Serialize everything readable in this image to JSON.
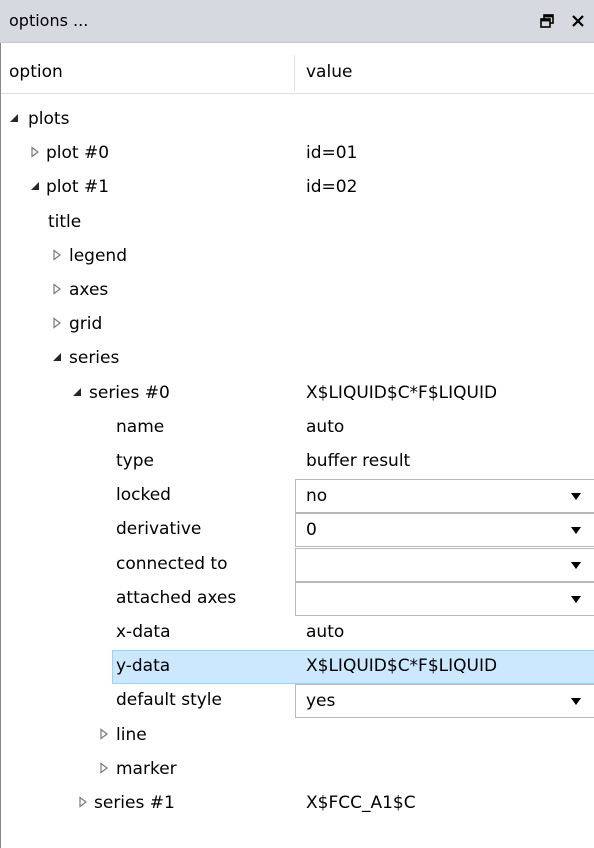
{
  "window": {
    "title": "options ...",
    "float_icon": "restore-window-icon",
    "close_icon": "close-icon"
  },
  "columns": {
    "option": "option",
    "value": "value"
  },
  "rows": [
    {
      "label": "plots",
      "value": "",
      "expander": "expanded"
    },
    {
      "label": "plot #0",
      "value": "id=01",
      "expander": "collapsed"
    },
    {
      "label": "plot #1",
      "value": "id=02",
      "expander": "expanded"
    },
    {
      "label": "title",
      "value": "",
      "expander": "none"
    },
    {
      "label": "legend",
      "value": "",
      "expander": "collapsed"
    },
    {
      "label": "axes",
      "value": "",
      "expander": "collapsed"
    },
    {
      "label": "grid",
      "value": "",
      "expander": "collapsed"
    },
    {
      "label": "series",
      "value": "",
      "expander": "expanded"
    },
    {
      "label": "series #0",
      "value": "X$LIQUID$C*F$LIQUID",
      "expander": "expanded"
    },
    {
      "label": "name",
      "value": "auto",
      "expander": "none"
    },
    {
      "label": "type",
      "value": "buffer result",
      "expander": "none"
    },
    {
      "label": "locked",
      "value": "no",
      "expander": "none",
      "editor": "combo"
    },
    {
      "label": "derivative",
      "value": "0",
      "expander": "none",
      "editor": "combo"
    },
    {
      "label": "connected to",
      "value": "",
      "expander": "none",
      "editor": "combo"
    },
    {
      "label": "attached axes",
      "value": "",
      "expander": "none",
      "editor": "combo"
    },
    {
      "label": "x-data",
      "value": "auto",
      "expander": "none"
    },
    {
      "label": "y-data",
      "value": "X$LIQUID$C*F$LIQUID",
      "expander": "none",
      "selected": true
    },
    {
      "label": "default style",
      "value": "yes",
      "expander": "none",
      "editor": "combo"
    },
    {
      "label": "line",
      "value": "",
      "expander": "collapsed"
    },
    {
      "label": "marker",
      "value": "",
      "expander": "collapsed"
    },
    {
      "label": "series #1",
      "value": "X$FCC_A1$C",
      "expander": "collapsed"
    }
  ],
  "colors": {
    "titlebar": "#d6d9df",
    "selection": "#cce8ff",
    "selection_border": "#99d1ff"
  }
}
